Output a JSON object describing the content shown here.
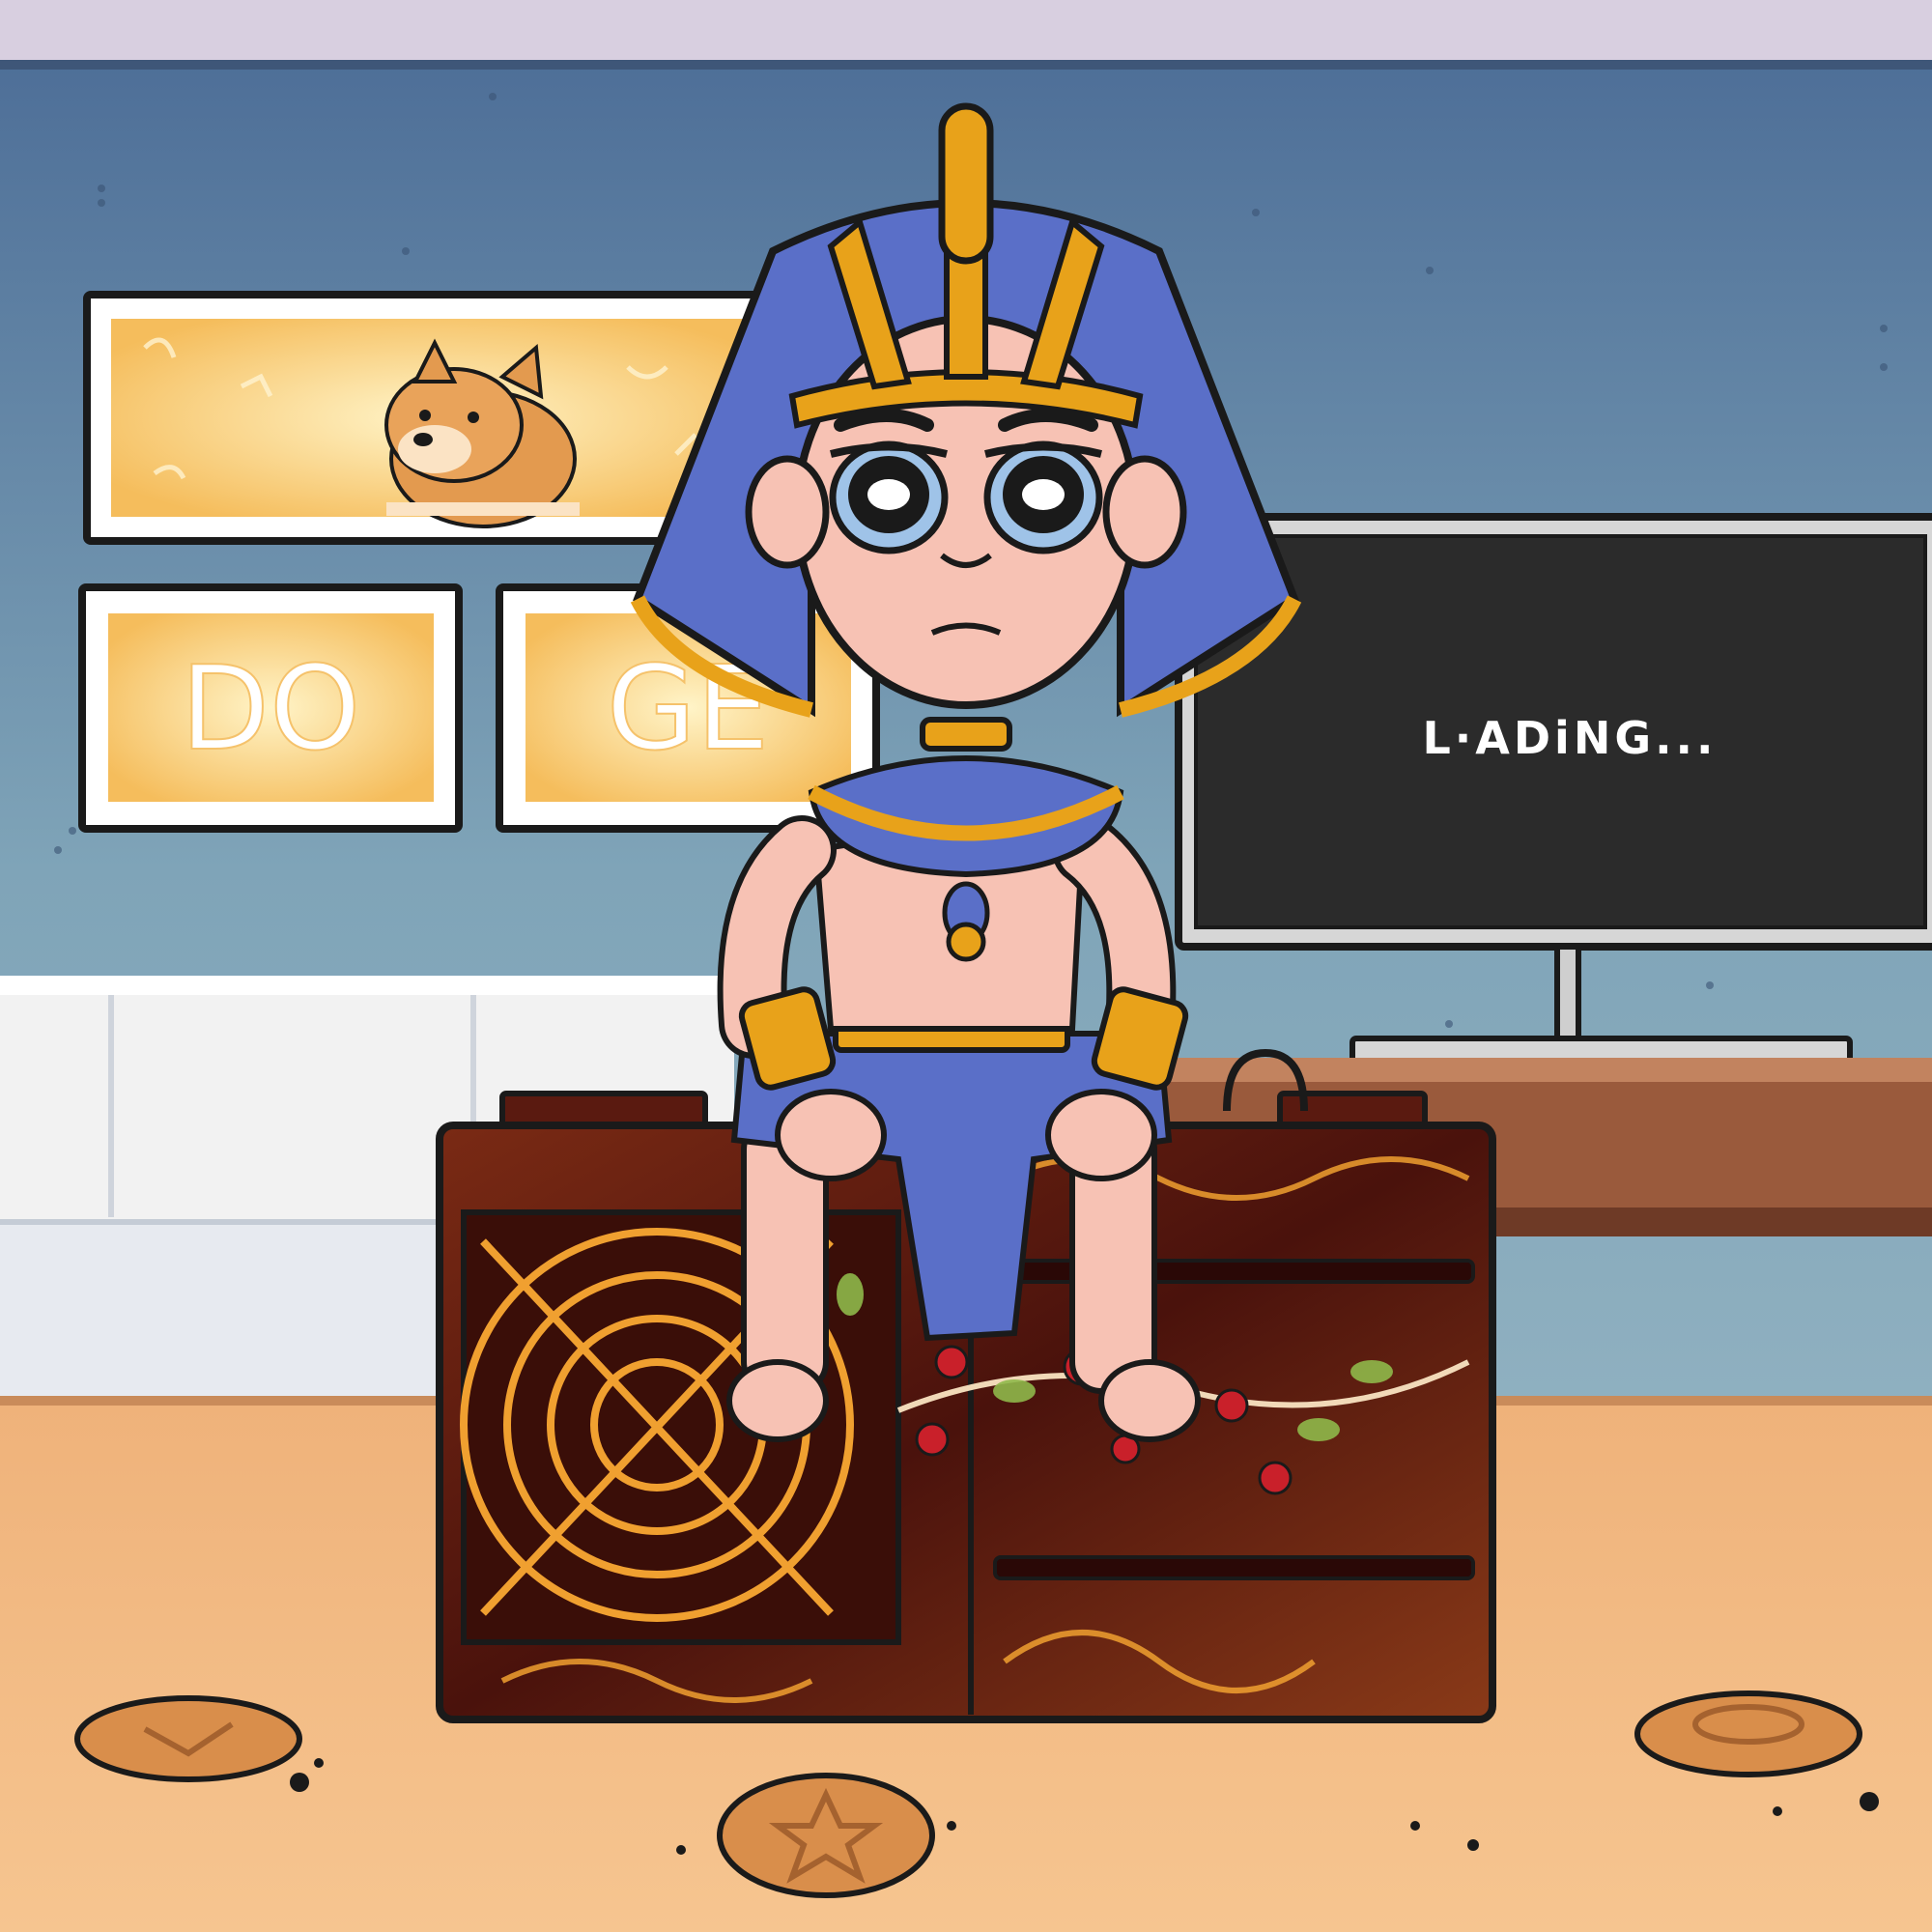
{
  "scene": {
    "wall_art": {
      "panel_left_text": "DO",
      "panel_right_text": "GE"
    },
    "tv": {
      "screen_text": "L·ADiNG..."
    }
  },
  "colors": {
    "wall": "#5f8aa8",
    "ceiling": "#d8cfe0",
    "floor": "#f2b980",
    "pharaoh_blue": "#5a6fc8",
    "gold": "#e8a21a",
    "skin": "#f7c2b4",
    "miner_brown": "#5a1a10",
    "tv_screen": "#2b2b2b"
  }
}
